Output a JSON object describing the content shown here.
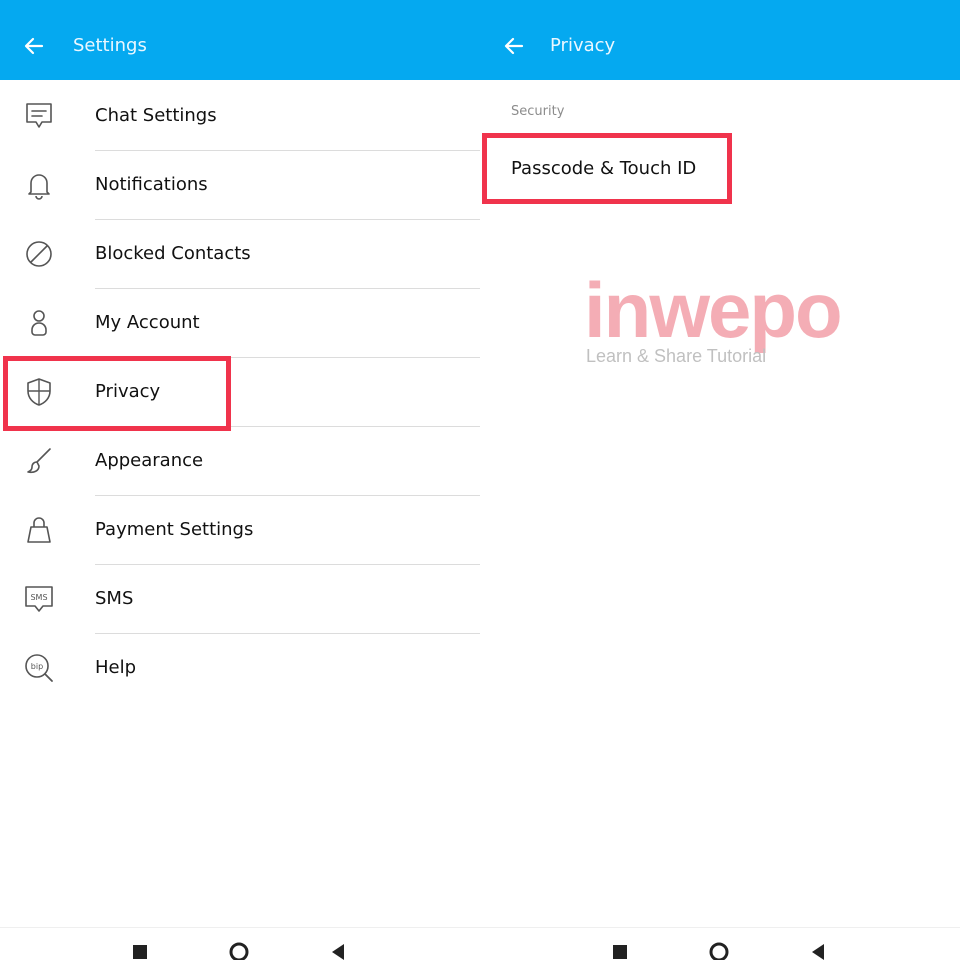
{
  "settings": {
    "title": "Settings",
    "items": [
      {
        "label": "Chat Settings",
        "icon": "chat-icon"
      },
      {
        "label": "Notifications",
        "icon": "bell-icon"
      },
      {
        "label": "Blocked Contacts",
        "icon": "blocked-icon"
      },
      {
        "label": "My Account",
        "icon": "person-icon"
      },
      {
        "label": "Privacy",
        "icon": "shield-icon"
      },
      {
        "label": "Appearance",
        "icon": "brush-icon"
      },
      {
        "label": "Payment Settings",
        "icon": "bag-icon"
      },
      {
        "label": "SMS",
        "icon": "sms-icon"
      },
      {
        "label": "Help",
        "icon": "help-icon"
      }
    ],
    "sms_icon_text": "SMS",
    "help_icon_text": "bip"
  },
  "privacy": {
    "title": "Privacy",
    "section": "Security",
    "item": "Passcode & Touch ID"
  },
  "watermark": {
    "brand": "inwepo",
    "tagline": "Learn & Share Tutorial"
  },
  "colors": {
    "topbar": "#05a9f0",
    "highlight": "#f0334c",
    "separator": "#dcdcdc"
  }
}
